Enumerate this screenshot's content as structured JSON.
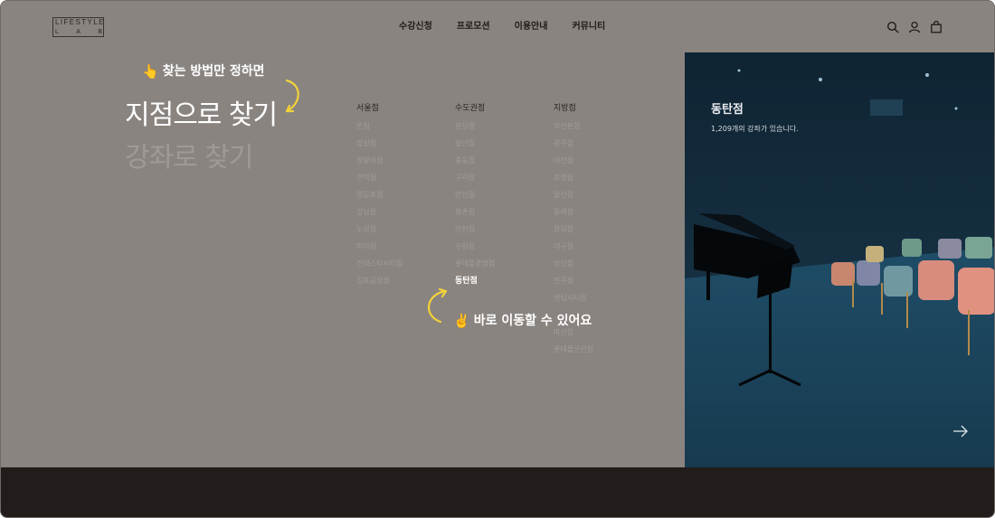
{
  "header": {
    "logo_top": "LIFESTYLE",
    "logo_letters": [
      "L",
      "A",
      "B"
    ],
    "nav": [
      "수강신청",
      "프로모션",
      "이용안내",
      "커뮤니티"
    ]
  },
  "icons": [
    "search-icon",
    "user-icon",
    "shopping-bag-icon"
  ],
  "hero": {
    "hint_top": "찾는 방법만 정하면",
    "title_active": "지점으로 찾기",
    "title_inactive": "강좌로 찾기",
    "hint_bottom": "바로 이동할 수 있어요"
  },
  "columns": [
    {
      "header": "서울점",
      "items": [
        "본점",
        "잠실점",
        "청량리점",
        "관악점",
        "영등포점",
        "강남점",
        "노원점",
        "미아점",
        "건대스타시티점",
        "김포공항점"
      ]
    },
    {
      "header": "수도권점",
      "items": [
        "분당점",
        "일산점",
        "중동점",
        "구리점",
        "안산점",
        "평촌점",
        "인천점",
        "수원점",
        "롯데몰광명점",
        "동탄점"
      ]
    },
    {
      "header": "지방점",
      "items": [
        "부산본점",
        "광주점",
        "대전점",
        "포항점",
        "울산점",
        "동래점",
        "창원점",
        "대구점",
        "상인점",
        "전주점",
        "센텀시티점",
        "",
        "마산점",
        "롯데몰군산점"
      ]
    }
  ],
  "active_branch": "동탄점",
  "panel": {
    "branch_name": "동탄점",
    "course_count": "1,209개의 강좌가 있습니다."
  },
  "colors": {
    "overlay": "#8a8480",
    "footer": "#221d1b",
    "accent_yellow": "#f2d23a"
  }
}
